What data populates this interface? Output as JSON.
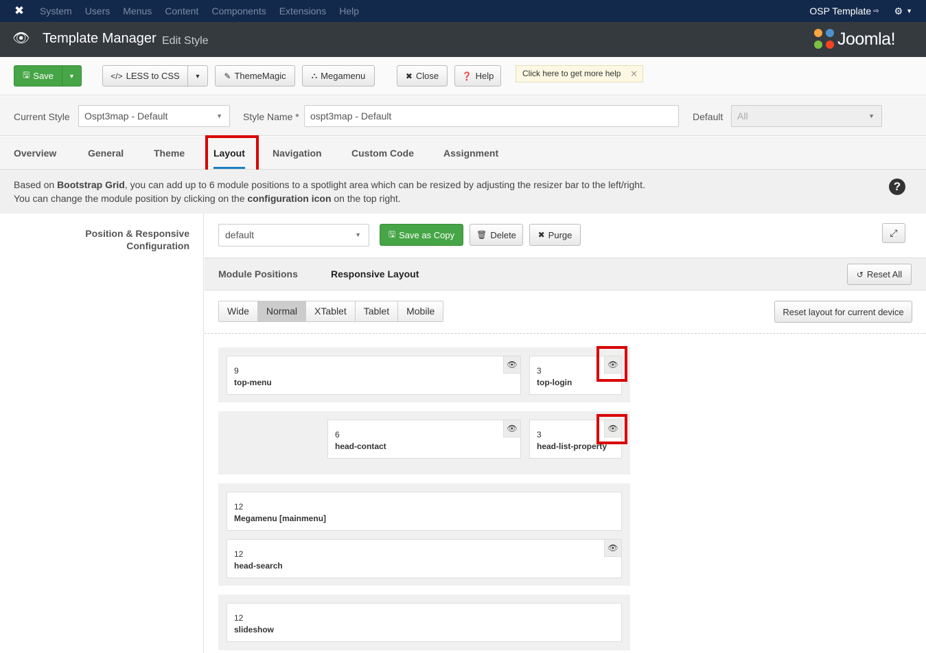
{
  "topnav": {
    "menu": [
      "System",
      "Users",
      "Menus",
      "Content",
      "Components",
      "Extensions",
      "Help"
    ],
    "site_name": "OSP Template",
    "site_icon": "external-link-icon",
    "settings_icon": "gear-icon"
  },
  "header": {
    "title": "Template Manager",
    "subtitle": "Edit Style",
    "brand": "Joomla!"
  },
  "toolbar": {
    "save": "Save",
    "less": "LESS to CSS",
    "thememagic": "ThemeMagic",
    "megamenu": "Megamenu",
    "close": "Close",
    "help": "Help",
    "tip": "Click here to get more help"
  },
  "style_row": {
    "current_style_label": "Current Style",
    "current_style_value": "Ospt3map - Default",
    "style_name_label": "Style Name *",
    "style_name_value": "ospt3map - Default",
    "default_label": "Default",
    "default_value": "All"
  },
  "tabs": [
    "Overview",
    "General",
    "Theme",
    "Layout",
    "Navigation",
    "Custom Code",
    "Assignment"
  ],
  "active_tab": "Layout",
  "info": {
    "line1_a": "Based on ",
    "line1_b": "Bootstrap Grid",
    "line1_c": ", you can add up to 6 module positions to a spotlight area which can be resized by adjusting the resizer bar to the left/right.",
    "line2_a": "You can change the module position by clicking on the ",
    "line2_b": "configuration icon",
    "line2_c": " on the top right."
  },
  "config_label_1": "Position & Responsive",
  "config_label_2": "Configuration",
  "layout_controls": {
    "layout_value": "default",
    "save_copy": "Save as Copy",
    "delete": "Delete",
    "purge": "Purge"
  },
  "subtabs": {
    "module_positions": "Module Positions",
    "responsive_layout": "Responsive Layout",
    "reset_all": "Reset All"
  },
  "devices": [
    "Wide",
    "Normal",
    "XTablet",
    "Tablet",
    "Mobile"
  ],
  "active_device": "Normal",
  "reset_device": "Reset layout for current device",
  "modules": [
    {
      "span": "9",
      "name": "top-menu"
    },
    {
      "span": "3",
      "name": "top-login"
    },
    {
      "span": "6",
      "name": "head-contact"
    },
    {
      "span": "3",
      "name": "head-list-property"
    },
    {
      "span": "12",
      "name": "Megamenu [mainmenu]"
    },
    {
      "span": "12",
      "name": "head-search"
    },
    {
      "span": "12",
      "name": "slideshow"
    }
  ],
  "colors": {
    "topnav_bg": "#13294b",
    "header_bg": "#353a3f",
    "save_green": "#46a546",
    "highlight_red": "#d90000",
    "tab_underline": "#1a7fc1"
  }
}
